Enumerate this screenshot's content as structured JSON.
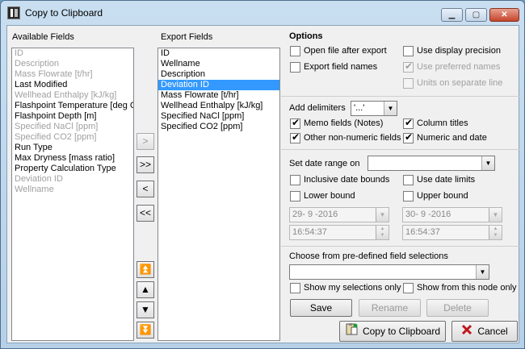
{
  "window": {
    "title": "Copy to Clipboard"
  },
  "available": {
    "label": "Available Fields",
    "items": [
      {
        "text": "ID",
        "enabled": false
      },
      {
        "text": "Description",
        "enabled": false
      },
      {
        "text": "Mass Flowrate [t/hr]",
        "enabled": false
      },
      {
        "text": "Last Modified",
        "enabled": true
      },
      {
        "text": "Wellhead Enthalpy [kJ/kg]",
        "enabled": false
      },
      {
        "text": "Flashpoint Temperature [deg C]",
        "enabled": true
      },
      {
        "text": "Flashpoint Depth [m]",
        "enabled": true
      },
      {
        "text": "Specified NaCl [ppm]",
        "enabled": false
      },
      {
        "text": "Specified CO2 [ppm]",
        "enabled": false
      },
      {
        "text": "Run Type",
        "enabled": true
      },
      {
        "text": "Max Dryness [mass ratio]",
        "enabled": true
      },
      {
        "text": "Property Calculation Type",
        "enabled": true
      },
      {
        "text": "Deviation ID",
        "enabled": false
      },
      {
        "text": "Wellname",
        "enabled": false
      }
    ]
  },
  "export": {
    "label": "Export Fields",
    "items": [
      {
        "text": "ID",
        "selected": false
      },
      {
        "text": "Wellname",
        "selected": false
      },
      {
        "text": "Description",
        "selected": false
      },
      {
        "text": "Deviation ID",
        "selected": true
      },
      {
        "text": "Mass Flowrate [t/hr]",
        "selected": false
      },
      {
        "text": "Wellhead Enthalpy [kJ/kg]",
        "selected": false
      },
      {
        "text": "Specified NaCl [ppm]",
        "selected": false
      },
      {
        "text": "Specified CO2 [ppm]",
        "selected": false
      }
    ]
  },
  "move": {
    "add": ">",
    "add_all": ">>",
    "remove": "<",
    "remove_all": "<<"
  },
  "options": {
    "title": "Options",
    "open_file": "Open file after export",
    "export_names": "Export field names",
    "display_precision": "Use display precision",
    "preferred_names": "Use preferred names",
    "units_separate": "Units on separate line"
  },
  "delimiters": {
    "label": "Add delimiters",
    "value": "'...'",
    "memo": "Memo fields (Notes)",
    "column_titles": "Column titles",
    "other_non_numeric": "Other non-numeric fields",
    "numeric_date": "Numeric and date"
  },
  "dates": {
    "label": "Set date range on",
    "value": "",
    "inclusive": "Inclusive date bounds",
    "use_limits": "Use date limits",
    "lower": "Lower bound",
    "upper": "Upper bound",
    "lower_date": "29- 9 -2016",
    "lower_time": "16:54:37",
    "upper_date": "30- 9 -2016",
    "upper_time": "16:54:37"
  },
  "predefined": {
    "label": "Choose from pre-defined field selections",
    "value": "",
    "my_only": "Show my selections only",
    "node_only": "Show from this node only",
    "save": "Save",
    "rename": "Rename",
    "delete": "Delete"
  },
  "footer": {
    "copy": "Copy to Clipboard",
    "cancel": "Cancel"
  },
  "colors": {
    "selection": "#3399ff",
    "disabled_text": "#a0a0a0"
  }
}
